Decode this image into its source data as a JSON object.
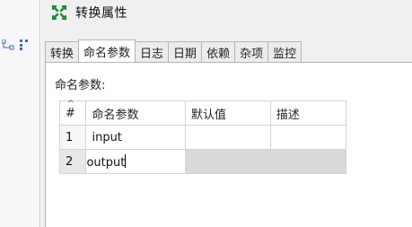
{
  "left_toolbar": {
    "icons": [
      "hierarchy-icon",
      "grid-icon"
    ]
  },
  "dialog": {
    "title": "转换属性",
    "icon": "transform-icon"
  },
  "tabs": [
    {
      "label": "转换",
      "active": false
    },
    {
      "label": "命名参数",
      "active": true
    },
    {
      "label": "日志",
      "active": false
    },
    {
      "label": "日期",
      "active": false
    },
    {
      "label": "依赖",
      "active": false
    },
    {
      "label": "杂项",
      "active": false
    },
    {
      "label": "监控",
      "active": false
    }
  ],
  "params_section": {
    "label": "命名参数:",
    "columns": [
      "#",
      "命名参数",
      "默认值",
      "描述"
    ],
    "rows": [
      {
        "num": "1",
        "name": "input",
        "default": "",
        "desc": ""
      },
      {
        "num": "2",
        "name": "output",
        "default": "",
        "desc": ""
      }
    ]
  }
}
